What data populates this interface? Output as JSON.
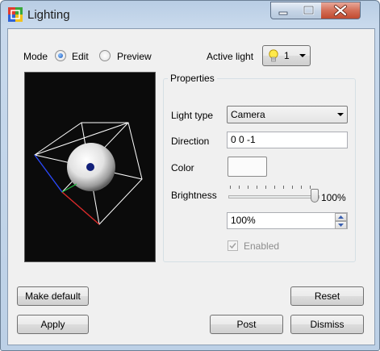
{
  "window": {
    "title": "Lighting",
    "icon": "app-color-grid-icon"
  },
  "mode": {
    "label": "Mode",
    "options": [
      "Edit",
      "Preview"
    ],
    "selected": "Edit"
  },
  "active_light": {
    "label": "Active light",
    "value": "1",
    "icon": "lightbulb-icon"
  },
  "properties": {
    "group_title": "Properties",
    "light_type": {
      "label": "Light type",
      "value": "Camera"
    },
    "direction": {
      "label": "Direction",
      "value": "0 0 -1"
    },
    "color": {
      "label": "Color",
      "value": "#fbfbfb"
    },
    "brightness": {
      "label": "Brightness",
      "value_text": "100%",
      "level": 1.0,
      "spin_value": "100%"
    },
    "enabled": {
      "label": "Enabled",
      "checked": true,
      "disabled": true
    }
  },
  "buttons": {
    "make_default": "Make default",
    "reset": "Reset",
    "apply": "Apply",
    "post": "Post",
    "dismiss": "Dismiss"
  }
}
